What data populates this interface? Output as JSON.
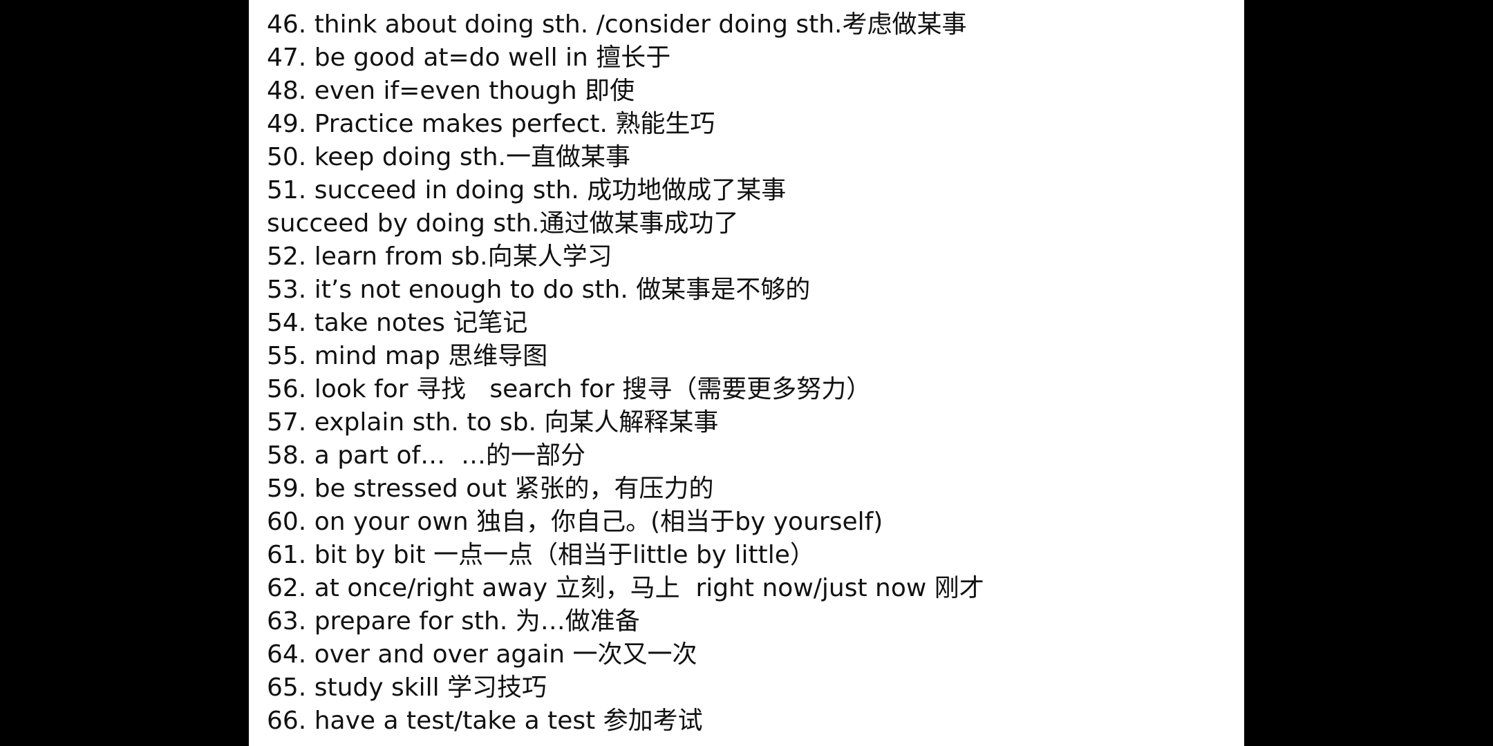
{
  "document": {
    "lines": [
      "46. think about doing sth. /consider doing sth.考虑做某事",
      "47. be good at=do well in 擅长于",
      "48. even if=even though 即使",
      "49. Practice makes perfect. 熟能生巧",
      "50. keep doing sth.一直做某事",
      "51. succeed in doing sth. 成功地做成了某事",
      "succeed by doing sth.通过做某事成功了",
      "52. learn from sb.向某人学习",
      "53. it’s not enough to do sth. 做某事是不够的",
      "54. take notes 记笔记",
      "55. mind map 思维导图",
      "56. look for 寻找   search for 搜寻（需要更多努力）",
      "57. explain sth. to sb. 向某人解释某事",
      "58. a part of…  …的一部分",
      "59. be stressed out 紧张的，有压力的",
      "60. on your own 独自，你自己。(相当于by yourself)",
      "61. bit by bit 一点一点（相当于little by little）",
      "62. at once/right away 立刻，马上  right now/just now 刚才",
      "63. prepare for sth. 为…做准备",
      "64. over and over again 一次又一次",
      "65. study skill 学习技巧",
      "66. have a test/take a test 参加考试"
    ]
  }
}
